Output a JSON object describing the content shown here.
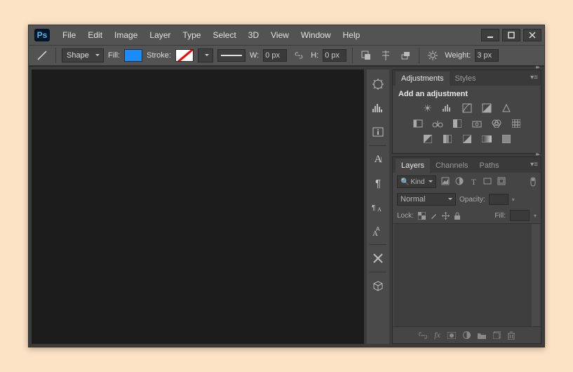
{
  "menubar": [
    "File",
    "Edit",
    "Image",
    "Layer",
    "Type",
    "Select",
    "3D",
    "View",
    "Window",
    "Help"
  ],
  "options": {
    "mode": "Shape",
    "fill_label": "Fill:",
    "stroke_label": "Stroke:",
    "w_label": "W:",
    "w_value": "0 px",
    "h_label": "H:",
    "h_value": "0 px",
    "weight_label": "Weight:",
    "weight_value": "3 px"
  },
  "adjustments": {
    "tabs": [
      "Adjustments",
      "Styles"
    ],
    "heading": "Add an adjustment"
  },
  "layers": {
    "tabs": [
      "Layers",
      "Channels",
      "Paths"
    ],
    "kind_label": "Kind",
    "blend_mode": "Normal",
    "opacity_label": "Opacity:",
    "lock_label": "Lock:",
    "fill_label": "Fill:",
    "search_placeholder": "ρ"
  }
}
